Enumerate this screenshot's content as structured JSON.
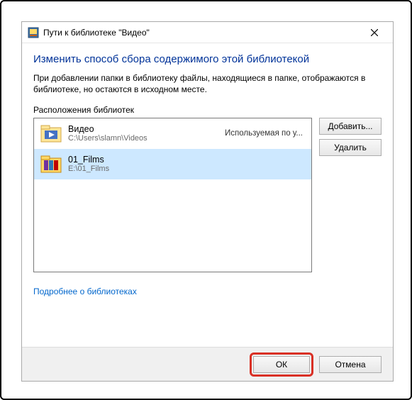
{
  "titlebar": {
    "title": "Пути к библиотеке \"Видео\""
  },
  "instruction": "Изменить способ сбора содержимого этой библиотекой",
  "description": "При добавлении папки в библиотеку файлы, находящиеся в папке, отображаются в библиотеке, но остаются в исходном месте.",
  "group_label": "Расположения библиотек",
  "locations": [
    {
      "title": "Видео",
      "path": "C:\\Users\\slamn\\Videos",
      "status": "Используемая по у...",
      "selected": false
    },
    {
      "title": "01_Films",
      "path": "E:\\01_Films",
      "status": "",
      "selected": true
    }
  ],
  "buttons": {
    "add": "Добавить...",
    "remove": "Удалить",
    "ok": "ОК",
    "cancel": "Отмена"
  },
  "link": "Подробнее о библиотеках"
}
